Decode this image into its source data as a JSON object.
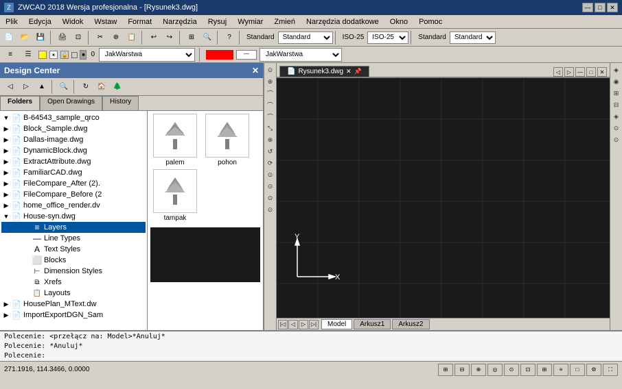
{
  "titlebar": {
    "title": "ZWCAD 2018 Wersja profesjonalna - [Rysunek3.dwg]",
    "icon": "Z",
    "min": "—",
    "max": "□",
    "close": "✕"
  },
  "menubar": {
    "items": [
      "Plik",
      "Edycja",
      "Widok",
      "Wstaw",
      "Format",
      "Narzędzia",
      "Rysuj",
      "Wymiar",
      "Zmień",
      "Narzędzia dodatkowe",
      "Okno",
      "Pomoc"
    ]
  },
  "toolbar1": {
    "standard_label": "Standard",
    "iso_label": "ISO-25",
    "standard2_label": "Standard"
  },
  "layer_bar": {
    "layer_name": "JakWarstwa",
    "layer_name2": "JakWarstwa"
  },
  "design_center": {
    "title": "Design Center",
    "close": "✕",
    "tabs": [
      "Folders",
      "Open Drawings",
      "History"
    ],
    "tree_items": [
      {
        "id": "b64543",
        "label": "B-64543_sample_qrco",
        "level": 0,
        "expanded": true,
        "type": "file"
      },
      {
        "id": "block_sample",
        "label": "Block_Sample.dwg",
        "level": 0,
        "expanded": false,
        "type": "file"
      },
      {
        "id": "dallas",
        "label": "Dallas-image.dwg",
        "level": 0,
        "expanded": false,
        "type": "file"
      },
      {
        "id": "dynamicblock",
        "label": "DynamicBlock.dwg",
        "level": 0,
        "expanded": false,
        "type": "file"
      },
      {
        "id": "extractattribute",
        "label": "ExtractAttribute.dwg",
        "level": 0,
        "expanded": false,
        "type": "file"
      },
      {
        "id": "familiarcad",
        "label": "FamiliarCAD.dwg",
        "level": 0,
        "expanded": false,
        "type": "file"
      },
      {
        "id": "filecompare_after",
        "label": "FileCompare_After (2).",
        "level": 0,
        "expanded": false,
        "type": "file"
      },
      {
        "id": "filecompare_before",
        "label": "FileCompare_Before (2",
        "level": 0,
        "expanded": false,
        "type": "file"
      },
      {
        "id": "home_office",
        "label": "home_office_render.dw",
        "level": 0,
        "expanded": false,
        "type": "file"
      },
      {
        "id": "housesyn",
        "label": "House-syn.dwg",
        "level": 0,
        "expanded": true,
        "type": "file"
      },
      {
        "id": "layers",
        "label": "Layers",
        "level": 1,
        "expanded": false,
        "type": "layers",
        "selected": true
      },
      {
        "id": "linetypes",
        "label": "Line Types",
        "level": 1,
        "expanded": false,
        "type": "linetypes"
      },
      {
        "id": "textstyles",
        "label": "Text Styles",
        "level": 1,
        "expanded": false,
        "type": "textstyles"
      },
      {
        "id": "blocks",
        "label": "Blocks",
        "level": 1,
        "expanded": false,
        "type": "blocks"
      },
      {
        "id": "dimstyles",
        "label": "Dimension Styles",
        "level": 1,
        "expanded": false,
        "type": "dimstyles"
      },
      {
        "id": "xrefs",
        "label": "Xrefs",
        "level": 1,
        "expanded": false,
        "type": "xrefs"
      },
      {
        "id": "layouts",
        "label": "Layouts",
        "level": 1,
        "expanded": false,
        "type": "layouts"
      },
      {
        "id": "houseplan",
        "label": "HousePlan_MText.dw",
        "level": 0,
        "expanded": false,
        "type": "file"
      },
      {
        "id": "importexport",
        "label": "ImportExportDGN_Sam",
        "level": 0,
        "expanded": false,
        "type": "file"
      }
    ],
    "preview_tiles": [
      {
        "id": "palem",
        "label": "palem"
      },
      {
        "id": "pohon",
        "label": "pohon"
      },
      {
        "id": "tampak",
        "label": "tampak"
      }
    ]
  },
  "cad": {
    "tab_label": "Rysunek3.dwg",
    "model_tabs": [
      "Model",
      "Arkusz1",
      "Arkusz2"
    ]
  },
  "commands": [
    "Polecenie: <przełącz na: Model>*Anuluj*",
    "Polecenie: *Anuluj*",
    "Polecenie:"
  ],
  "statusbar": {
    "coords": "271.1916, 114.3466, 0.0000"
  },
  "left_tools": [
    "◎",
    "⊙",
    "⌒",
    "⌒",
    "⌒",
    "⤡",
    "⊕",
    "↺",
    "⟳",
    "⊙",
    "⊙",
    "⊙",
    "⊙",
    "⊕"
  ],
  "right_palette": [
    "◈",
    "◉",
    "⊞",
    "⊟",
    "◈",
    "⊙",
    "⊙"
  ]
}
